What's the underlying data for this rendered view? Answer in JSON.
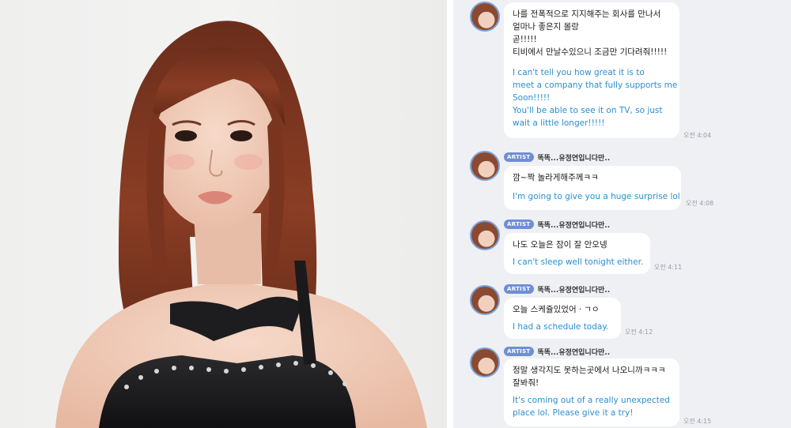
{
  "messages": [
    {
      "show_header": false,
      "artist_badge": "",
      "sender": "",
      "korean": [
        "나를 전폭적으로 지지해주는 회사를 만나서",
        "얼마나 좋은지 몰랑",
        "곧!!!!!",
        "티비에서 만날수있으니 조금만 기다려줘!!!!!"
      ],
      "english": [
        "I can't tell you how great it is to",
        "meet a company that fully supports me",
        "Soon!!!!!",
        "You'll be able to see it on TV, so just",
        "wait a little longer!!!!!"
      ],
      "time": "오전 4:04"
    },
    {
      "show_header": true,
      "artist_badge": "ARTIST",
      "sender": "똑똑...유정연입니다만..",
      "korean": [
        "깜~짝 놀라게해주께ㅋㅋ"
      ],
      "english": [
        "I'm going to give you a huge surprise lol"
      ],
      "time": "오전 4:08"
    },
    {
      "show_header": true,
      "artist_badge": "ARTIST",
      "sender": "똑똑...유정연입니다만..",
      "korean": [
        "나도 오늘은 잠이 잘 안오넹"
      ],
      "english": [
        "I can't sleep well tonight either."
      ],
      "time": "오전 4:11"
    },
    {
      "show_header": true,
      "artist_badge": "ARTIST",
      "sender": "똑똑...유정연입니다만..",
      "korean": [
        "오늘 스케쥴있었어ㆍㄱㅇ"
      ],
      "english": [
        "I had a schedule today."
      ],
      "time": "오전 4:12"
    },
    {
      "show_header": true,
      "artist_badge": "ARTIST",
      "sender": "똑똑...유정연입니다만..",
      "korean": [
        "정말 생각지도 못하는곳에서 나오니까ㅋㅋㅋ",
        "잘봐줘!"
      ],
      "english": [
        "It's coming out of a really unexpected",
        "place lol. Please give it a try!"
      ],
      "time": "오전 4:15"
    }
  ]
}
